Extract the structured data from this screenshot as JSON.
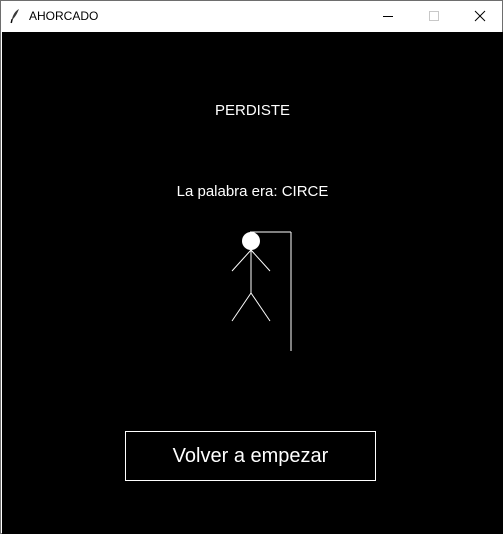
{
  "window": {
    "title": "AHORCADO",
    "icon": "feather-icon",
    "controls": [
      "minimize-icon",
      "maximize-icon",
      "close-icon"
    ]
  },
  "game": {
    "result_text": "PERDISTE",
    "word_text": "La palabra era: CIRCE",
    "restart_label": "Volver a empezar",
    "hangman_stage": "complete"
  },
  "colors": {
    "background": "#000000",
    "foreground": "#ffffff",
    "titlebar": "#ffffff"
  }
}
